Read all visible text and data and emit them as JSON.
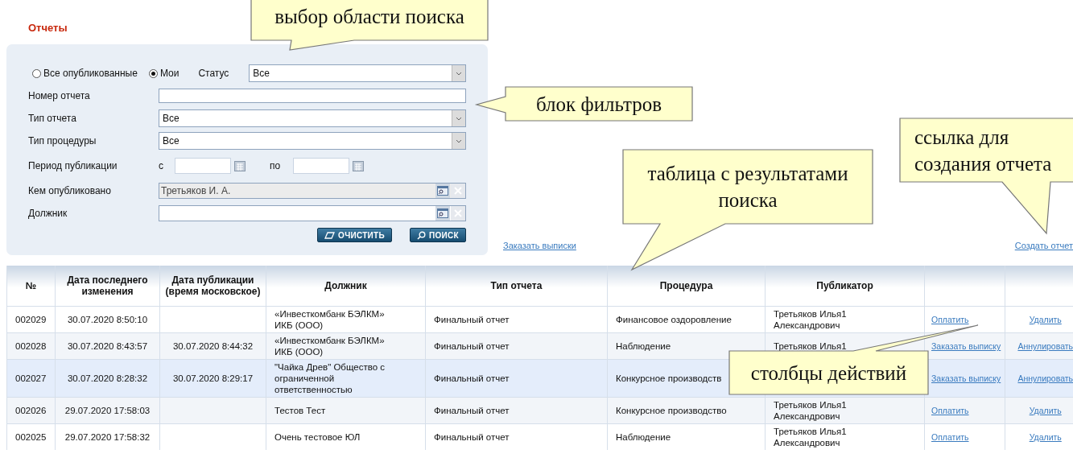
{
  "page_title": "Отчеты",
  "filters": {
    "scope": [
      {
        "label": "Все опубликованные",
        "selected": false
      },
      {
        "label": "Мои",
        "selected": true
      }
    ],
    "status": {
      "label": "Статус",
      "value": "Все"
    },
    "fields": [
      {
        "kind": "text",
        "label": "Номер отчета"
      },
      {
        "kind": "select",
        "label": "Тип отчета",
        "value": "Все"
      },
      {
        "kind": "select",
        "label": "Тип процедуры",
        "value": "Все"
      },
      {
        "kind": "period",
        "label": "Период публикации",
        "from_label": "с",
        "to_label": "по"
      },
      {
        "kind": "lookup",
        "label": "Кем опубликовано",
        "value": "Третьяков И. А.",
        "disabled": true
      },
      {
        "kind": "lookup",
        "label": "Должник",
        "disabled": false
      }
    ],
    "buttons": [
      {
        "kind": "clear",
        "label": "ОЧИСТИТЬ"
      },
      {
        "kind": "search",
        "label": "ПОИСК"
      }
    ]
  },
  "links": [
    "Заказать выписки",
    "Создать отчет"
  ],
  "table": {
    "columns": [
      "№",
      "Дата последнего изменения",
      "Дата публикации (время московское)",
      "Должник",
      "Тип отчета",
      "Процедура",
      "Публикатор"
    ],
    "rows": [
      {
        "number": "002029",
        "modified": "30.07.2020 8:50:10",
        "debtor": "«Инвесткомбанк БЭЛКМ» ИКБ (ООО)",
        "report_type": "Финальный отчет",
        "procedure": "Финансовое оздоровление",
        "publisher": "Третьяков Илья1 Александрович",
        "actions": [
          "Оплатить",
          "Удалить"
        ],
        "selected": false
      },
      {
        "number": "002028",
        "modified": "30.07.2020 8:43:57",
        "published": "30.07.2020 8:44:32",
        "debtor": "«Инвесткомбанк БЭЛКМ» ИКБ (ООО)",
        "report_type": "Финальный отчет",
        "procedure": "Наблюдение",
        "publisher": "Третьяков Илья1",
        "actions": [
          "Заказать выписку",
          "Аннулировать"
        ],
        "selected": false
      },
      {
        "number": "002027",
        "modified": "30.07.2020 8:28:32",
        "published": "30.07.2020 8:29:17",
        "debtor": "\"Чайка Древ\" Общество с ограниченной ответственностью",
        "report_type": "Финальный отчет",
        "procedure": "Конкурсное производств",
        "actions": [
          "Заказать выписку",
          "Аннулировать"
        ],
        "selected": true
      },
      {
        "number": "002026",
        "modified": "29.07.2020 17:58:03",
        "debtor": "Тестов Тест",
        "report_type": "Финальный отчет",
        "procedure": "Конкурсное производство",
        "publisher": "Третьяков Илья1 Александрович",
        "actions": [
          "Оплатить",
          "Удалить"
        ],
        "selected": false
      },
      {
        "number": "002025",
        "modified": "29.07.2020 17:58:32",
        "debtor": "Очень тестовое ЮЛ",
        "report_type": "Финальный отчет",
        "procedure": "Наблюдение",
        "publisher": "Третьяков Илья1 Александрович",
        "actions": [
          "Оплатить",
          "Удалить"
        ],
        "selected": false
      }
    ]
  },
  "callouts": [
    {
      "text": "выбор области поиска"
    },
    {
      "text": "блок фильтров"
    },
    {
      "text": "таблица с результатами поиска"
    },
    {
      "text": "ссылка для создания отчета"
    },
    {
      "text": "столбцы действий"
    }
  ]
}
